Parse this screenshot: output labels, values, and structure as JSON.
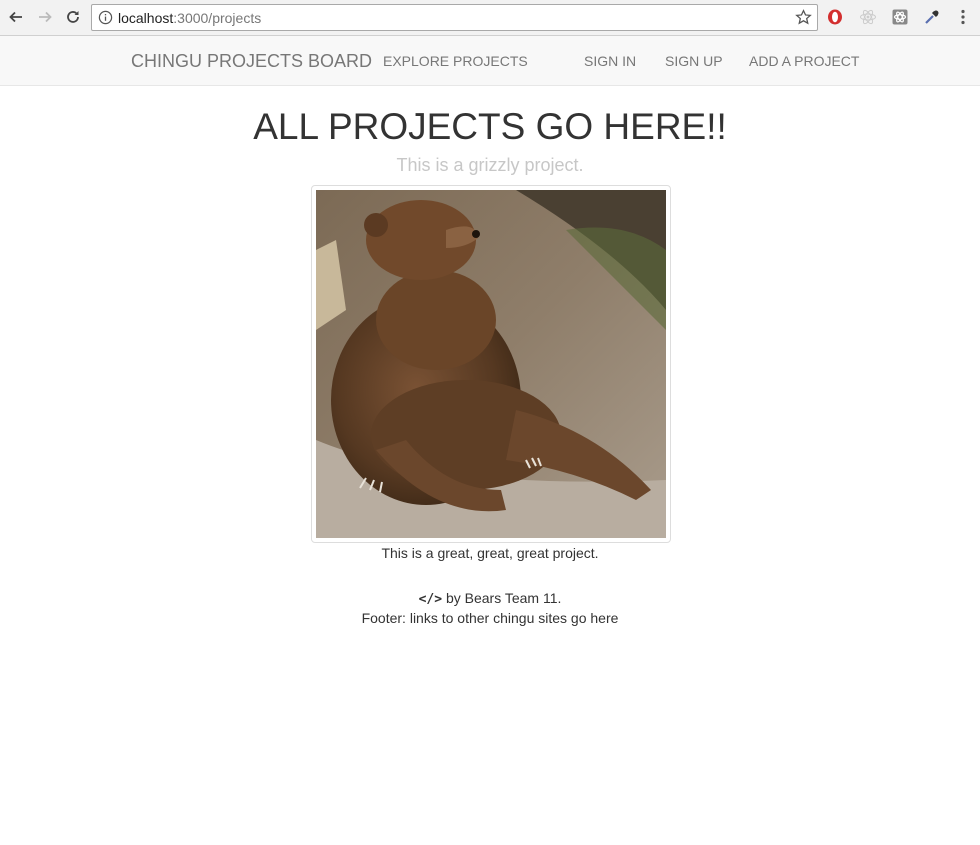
{
  "browser": {
    "url_host": "localhost",
    "url_path": ":3000/projects",
    "icons": [
      "back-icon",
      "forward-icon",
      "reload-icon",
      "info-icon",
      "star-icon",
      "opera-icon",
      "react-icon",
      "extension-icon",
      "eyedropper-icon",
      "menu-icon"
    ]
  },
  "navbar": {
    "brand": "CHINGU PROJECTS BOARD",
    "links": {
      "explore": "EXPLORE PROJECTS",
      "sign_in": "SIGN IN",
      "sign_up": "SIGN UP",
      "add_project": "ADD A PROJECT"
    }
  },
  "main": {
    "title": "ALL PROJECTS GO HERE!!",
    "project": {
      "subtitle": "This is a grizzly project.",
      "image_alt": "grizzly bear sitting",
      "description": "This is a great, great, great project."
    }
  },
  "footer": {
    "credit_icon": "</>",
    "credit_text": " by Bears Team 11.",
    "links_text": "Footer: links to other chingu sites go here"
  },
  "colors": {
    "navbar_bg": "#f8f8f8",
    "nav_link": "#777777",
    "subtitle": "#c7c7c7",
    "text": "#333333"
  }
}
